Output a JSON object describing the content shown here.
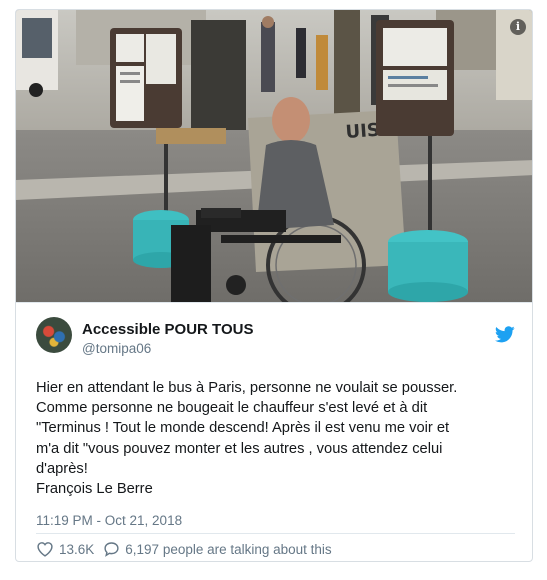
{
  "photo": {
    "info_icon": "info-icon",
    "graffiti_text": "UISIBLE"
  },
  "tweet": {
    "display_name": "Accessible POUR TOUS",
    "handle": "@tomipa06",
    "avatar_icon": "avatar-image",
    "brand_icon": "twitter-bird-icon",
    "brand_color": "#1da1f2",
    "text_lines": [
      "Hier en attendant le bus à Paris, personne ne voulait se pousser.",
      "Comme personne ne bougeait le chauffeur s'est levé et à dit",
      "\"Terminus ! Tout le monde descend! Après il est venu me voir et",
      "m'a dit \"vous pouvez monter et les autres , vous attendez celui",
      "d'après!",
      "François Le Berre"
    ],
    "timestamp": "11:19 PM - Oct 21, 2018",
    "likes": "13.6K",
    "like_icon": "heart-icon",
    "reply_icon": "comment-icon",
    "talking": "6,197 people are talking about this"
  }
}
